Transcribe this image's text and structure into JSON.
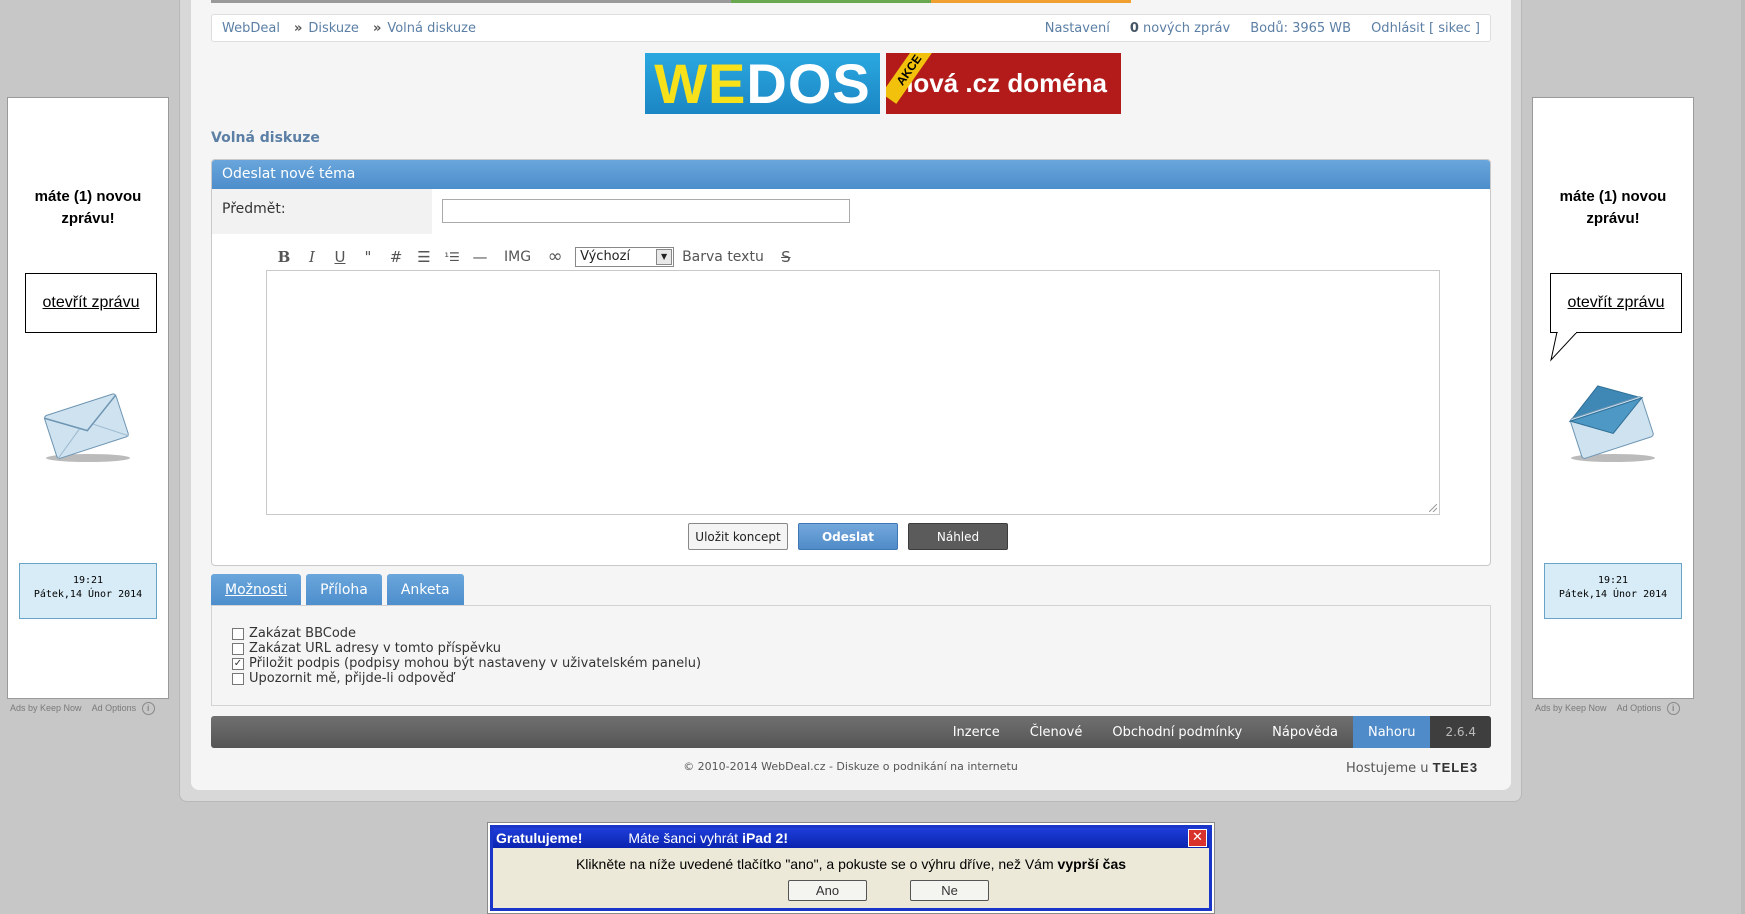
{
  "side_ads": {
    "left": {
      "message": "máte (1) novou zprávu!",
      "open_link": "otevřít zprávu",
      "time": "19:21",
      "date": "Pátek,14 Únor 2014",
      "ads_by": "Ads by Keep Now",
      "ad_options": "Ad Options"
    },
    "right": {
      "message": "máte (1) novou zprávu!",
      "open_link": "otevřít zprávu",
      "time": "19:21",
      "date": "Pátek,14 Únor 2014",
      "ads_by": "Ads by Keep Now",
      "ad_options": "Ad Options"
    }
  },
  "navbar": {
    "crumbs": [
      "WebDeal",
      "Diskuze",
      "Volná diskuze"
    ],
    "separator": "»",
    "settings": "Nastavení",
    "new_msgs_count": "0",
    "new_msgs_label": "nových zpráv",
    "points": "Bodů: 3965 WB",
    "logout": "Odhlásit [ sikec ]"
  },
  "banner": {
    "brand_we": "WE",
    "brand_dos": "DOS",
    "akce": "AKCE",
    "offer": "nová .cz doména"
  },
  "page_title": "Volná diskuze",
  "form": {
    "header": "Odeslat nové téma",
    "subject_label": "Předmět:",
    "subject_value": "",
    "toolbar": {
      "bold": "B",
      "italic": "I",
      "underline": "U",
      "quote": "\"",
      "code": "#",
      "list": "☰",
      "ordered_list": "¹☰",
      "hr": "—",
      "img": "IMG",
      "link": "∞",
      "font_select": "Výchozí",
      "text_color": "Barva textu",
      "strike": "S"
    },
    "buttons": {
      "save_draft": "Uložit koncept",
      "send": "Odeslat",
      "preview": "Náhled"
    }
  },
  "tabs": [
    {
      "label": "Možnosti",
      "active": true
    },
    {
      "label": "Příloha",
      "active": false
    },
    {
      "label": "Anketa",
      "active": false
    }
  ],
  "options": [
    {
      "label": "Zakázat BBCode",
      "checked": false
    },
    {
      "label": "Zakázat URL adresy v tomto příspěvku",
      "checked": false
    },
    {
      "label": "Přiložit podpis (podpisy mohou být nastaveny v uživatelském panelu)",
      "checked": true
    },
    {
      "label": "Upozornit mě, přijde-li odpověď",
      "checked": false
    }
  ],
  "footer": {
    "nav": [
      "Inzerce",
      "Členové",
      "Obchodní podmínky",
      "Nápověda",
      "Nahoru"
    ],
    "version": "2.6.4",
    "copyright": "© 2010-2014 WebDeal.cz - Diskuze o podnikání na internetu",
    "hosting_label": "Hostujeme u",
    "hosting_brand": "TELE3"
  },
  "popup": {
    "title_prefix": "Gratulujeme!",
    "title_text": "Máte šanci vyhrát",
    "title_bold": "iPad 2!",
    "close": "✕",
    "message": "Klikněte na níže uvedené tlačítko \"ano\", a pokuste se o výhru dříve, než Vám",
    "message_bold": "vyprší čas",
    "yes": "Ano",
    "no": "Ne"
  }
}
